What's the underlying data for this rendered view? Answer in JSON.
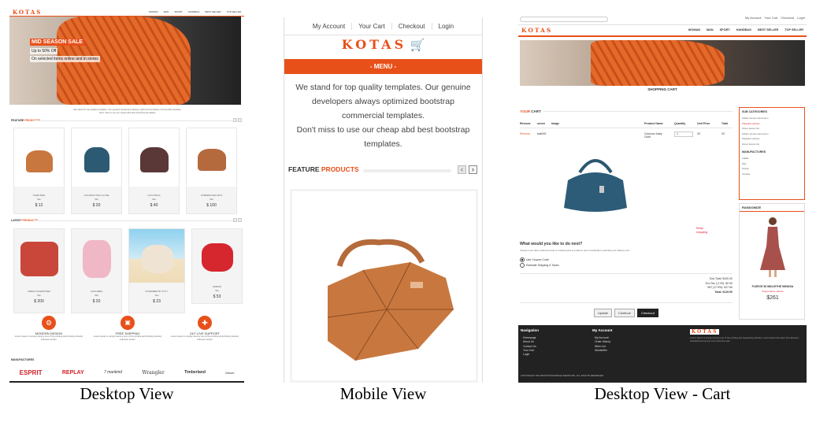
{
  "captions": {
    "desktop": "Desktop View",
    "mobile": "Mobile View",
    "cart": "Desktop View - Cart"
  },
  "desktop": {
    "logo": "KOTAS",
    "nav": [
      "WOMAN",
      "MAN",
      "SPORT",
      "HANDBAG",
      "BEST SELLER",
      "TOP SELLER"
    ],
    "hero": {
      "title": "MID SEASON SALE",
      "line1": "Up to 50% Off",
      "line2": "On selected items online and in stores"
    },
    "intro1": "We stand for top quality templates. Our genuine developers always optimized bootstrap commercial templates.",
    "intro2": "Don't miss to use our cheap abd best bootstrap templates.",
    "feature_title_a": "FEATURE",
    "feature_title_b": "PRODUCTS",
    "feature_items": [
      {
        "name": "TIGER BIKE",
        "price": "$ 12"
      },
      {
        "name": "COLORFUL BAG CLOSE",
        "price": "$ 20"
      },
      {
        "name": "LOCA BAGS",
        "price": "$ 40"
      },
      {
        "name": "SOMEBAG BAG BOX",
        "price": "$ 100"
      }
    ],
    "latest_title_a": "LATEST",
    "latest_title_b": "PRODUCTS",
    "latest_items": [
      {
        "name": "URBAN SUPERSTEEP",
        "price": "$ 200"
      },
      {
        "name": "CHOLOBES",
        "price": "$ 20"
      },
      {
        "name": "NOVEMBER BY KITTY",
        "price": "$ 23"
      },
      {
        "name": "HABASH",
        "price": "$ 53"
      }
    ],
    "sale_tag": "Sku",
    "features": [
      {
        "title": "MODERN DESIGN",
        "text": "Lorem ipsum is simply dummy text of the printing and printing industry unknown printer."
      },
      {
        "title": "FREE SHIPPING",
        "text": "Lorem ipsum is simply dummy text of the printing and printing industry unknown printer."
      },
      {
        "title": "24/7 LIVE SUPPORT",
        "text": "Lorem ipsum is simply dummy text of the printing and printing industry unknown printer."
      }
    ],
    "manufacturers_title": "MANUFACTURES",
    "brands": [
      "ESPRIT",
      "REPLAY",
      "7 mankind",
      "Wrangler",
      "Timberland",
      "Diesel"
    ]
  },
  "mobile": {
    "topnav": [
      "My Account",
      "Your Cart",
      "Checkout",
      "Login"
    ],
    "logo": "KOTAS",
    "menu": "- MENU -",
    "intro1": "We stand for top quality templates. Our genuine developers always optimized bootstrap commercial templates.",
    "intro2": "Don't miss to use our cheap abd best bootstrap templates.",
    "feature_a": "FEATURE",
    "feature_b": "PRODUCTS",
    "prev": "‹",
    "next": "›"
  },
  "cart": {
    "topnav": [
      "My Account",
      "Your Cart",
      "Checkout",
      "Login"
    ],
    "logo": "KOTAS",
    "nav": [
      "WOMAN",
      "MAN",
      "SPORT",
      "HANDBAG",
      "BEST SELLER",
      "TOP SELLER"
    ],
    "page_title": "SHOPPING CART",
    "your_cart_a": "YOUR",
    "your_cart_b": "CART",
    "columns": [
      "Remove",
      "seven",
      "Image",
      "Product Name",
      "Quantity",
      "Unit Price",
      "Total"
    ],
    "row": {
      "remove": "Remove",
      "code": "bak002",
      "name": "Colorous baby Cloth",
      "qty": "1",
      "unit": "20",
      "total": "20"
    },
    "bag_note_line1": "Retsy",
    "bag_note_line2": "shopping",
    "next_title": "What would you like to do next?",
    "next_text": "Choose if you have a discount code or reward points you want to use or would like to estimate your delivery cost.",
    "options": [
      "Use Coupon Code",
      "Estimate Shipping & Taxes"
    ],
    "totals": [
      {
        "label": "Sub-Total:",
        "value": "$100.00"
      },
      {
        "label": "Eco Tax (-2.00):",
        "value": "$2.00"
      },
      {
        "label": "VAT (17.5%):",
        "value": "$17.50"
      },
      {
        "label": "Total:",
        "value": "$119.50"
      }
    ],
    "buttons": {
      "update": "Update",
      "continue": "Continue",
      "checkout": "Checkout"
    },
    "side_cat_title": "SUB CATEGORIES",
    "side_cats": [
      "Nullam semper elementum",
      "Phasellus ultricies",
      "Donec laoreet dui",
      "Nullam semper elementum",
      "Phasellus ultricies",
      "Donec laoreet dui"
    ],
    "side_man_title": "MANUFACTURES",
    "side_man": [
      "Adidas",
      "Nike",
      "Dunlop",
      "Yamaha"
    ],
    "randomize_title": "RANDOMIZE",
    "random_item": {
      "name": "FLEECE 50 MIDLETHE WINDSA",
      "sub": "Suspendisse ultrices",
      "price": "$261"
    },
    "footer": {
      "nav_title": "Navigation",
      "nav_items": [
        "Homepage",
        "About Us",
        "Contact Us",
        "Your Cart",
        "Login"
      ],
      "acct_title": "My Account",
      "acct_items": [
        "My Account",
        "Order History",
        "Wish List",
        "Newsletter"
      ],
      "logo": "KOTAS",
      "about": "Lorem Ipsum is simply dummy text of the printing and typesetting industry. Lorem Ipsum has been the industry's standard dummy text ever since the year.",
      "copyright": "COPYRIGHT 2013 BOOTSTRAPPAGE TEMPLATE. ALL RIGHTS RESERVED"
    }
  },
  "colors": {
    "accent": "#e8501a",
    "price_red": "#e0223a",
    "footer_bg": "#222222"
  }
}
